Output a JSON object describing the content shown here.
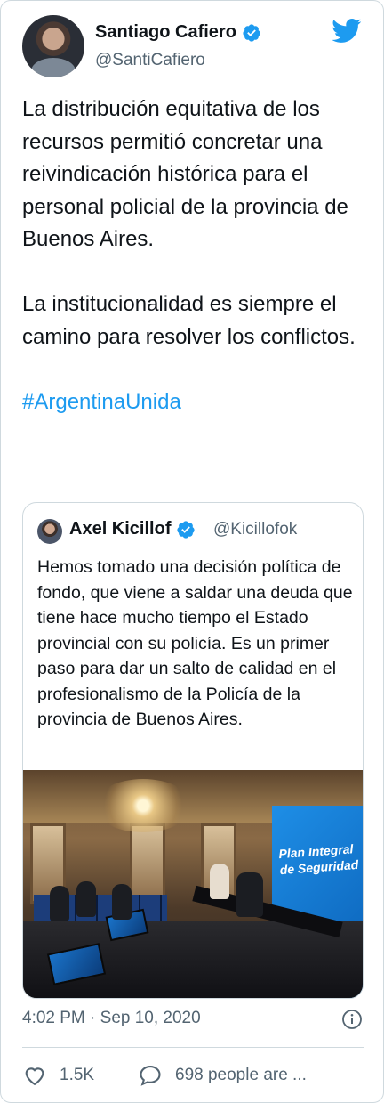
{
  "author": {
    "name": "Santiago Cafiero",
    "handle": "@SantiCafiero"
  },
  "tweet": {
    "paragraph1": "La distribución equitativa de los recursos permitió concretar una reivindicación histórica para el personal policial de la provincia de Buenos Aires.",
    "paragraph2": "La institucionalidad es siempre el camino para resolver los conflictos.",
    "hashtag": "#ArgentinaUnida"
  },
  "quoted": {
    "name": "Axel Kicillof",
    "handle": "@Kicillofok",
    "text": "Hemos tomado una decisión política de fondo, que viene a saldar una deuda que tiene hace mucho tiempo el Estado provincial con su policía. Es un primer paso para dar un salto de calidad en el profesionalismo de la Policía de la provincia de Buenos Aires.",
    "photo_banner": "Plan Integral de Seguridad"
  },
  "footer": {
    "timestamp": "4:02 PM · Sep 10, 2020",
    "likes": "1.5K",
    "replies": "698 people are ..."
  },
  "colors": {
    "accent": "#1d9bf0",
    "text": "#0f1419",
    "muted": "#536471",
    "border": "#cfd9de"
  },
  "icons": {
    "logo": "twitter-bird-icon",
    "verified": "verified-badge-icon",
    "info": "info-icon",
    "like": "heart-icon",
    "reply": "speech-bubble-icon"
  }
}
